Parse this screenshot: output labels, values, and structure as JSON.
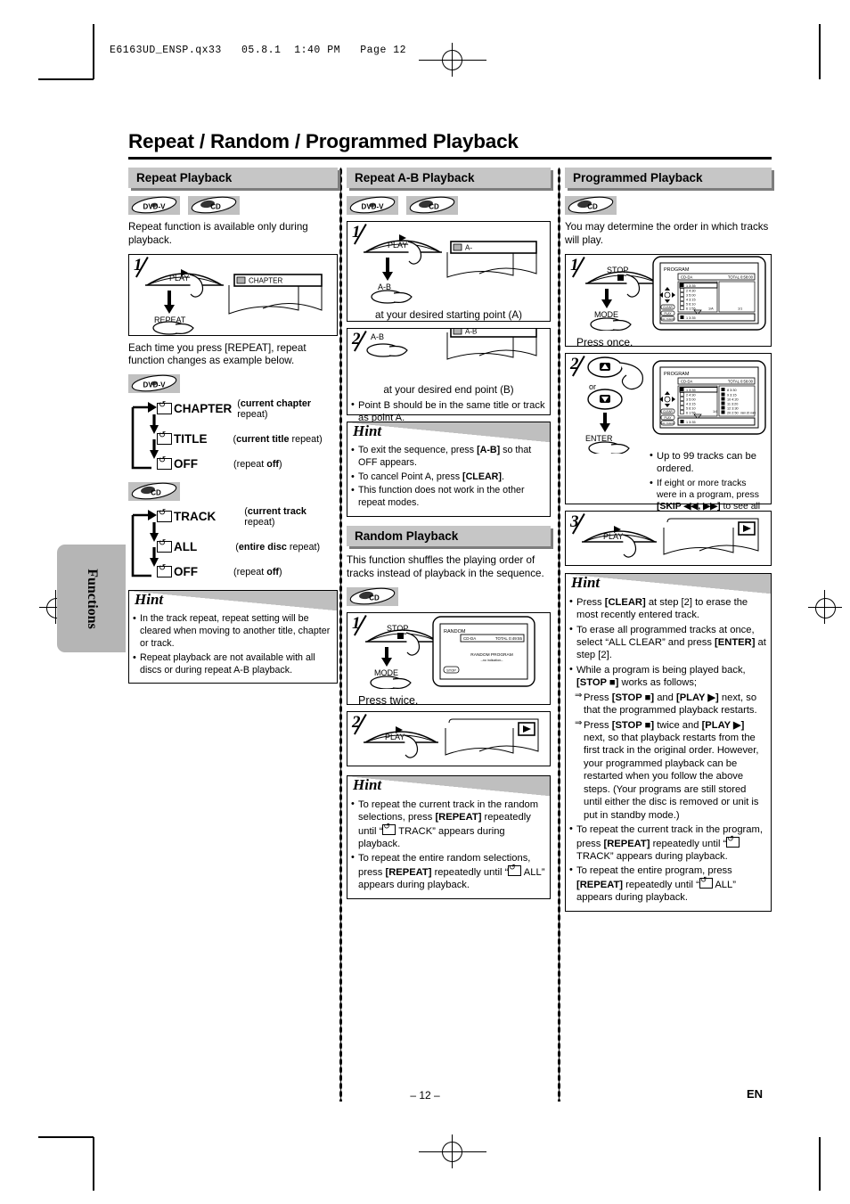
{
  "print_header": "E6163UD_ENSP.qx33   05.8.1  1:40 PM   Page 12",
  "page_title": "Repeat / Random / Programmed Playback",
  "side_tab": "Functions",
  "footer": {
    "page_number": "– 12 –",
    "lang": "EN"
  },
  "badges": {
    "dvd": "DVD-V",
    "cd": "CD"
  },
  "col1": {
    "header": "Repeat Playback",
    "intro": "Repeat function is available only during playback.",
    "step1": {
      "num": "1",
      "btn_top": "PLAY",
      "btn_bottom": "REPEAT",
      "osd": "CHAPTER"
    },
    "after_step": "Each time you press [REPEAT], repeat function changes as example below.",
    "cycle_dvd": [
      {
        "label": "CHAPTER",
        "note_b": "current chapter",
        "note_t": " repeat)"
      },
      {
        "label": "TITLE",
        "note_b": "current title",
        "note_t": " repeat)"
      },
      {
        "label": "OFF",
        "note_b": "off",
        "note_t": "(repeat "
      }
    ],
    "cycle_cd": [
      {
        "label": "TRACK",
        "note_b": "current track",
        "note_t": " repeat)"
      },
      {
        "label": "ALL",
        "note_b": "entire disc",
        "note_t": " repeat)"
      },
      {
        "label": "OFF",
        "note_b": "off",
        "note_t": "(repeat "
      }
    ],
    "hint_title": "Hint",
    "hints": [
      "In the track repeat, repeat setting will be cleared when moving to another title, chapter or track.",
      "Repeat playback are not available with all discs or during repeat A-B playback."
    ]
  },
  "col2": {
    "header": "Repeat A-B Playback",
    "step1": {
      "num": "1",
      "btn_top": "PLAY",
      "btn_bottom": "A-B",
      "osd": "A-",
      "caption": "at your desired starting point (A)"
    },
    "step2": {
      "num": "2",
      "btn_top": "A-B",
      "osd": "A-B",
      "caption": "at your desired end point (B)",
      "note": "Point B should be in the same title or track as point A."
    },
    "hint_title": "Hint",
    "hints_parts": [
      {
        "pre": "To exit the sequence, press ",
        "bold": "[A-B]",
        "post": " so that OFF appears."
      },
      {
        "pre": "To cancel Point A, press ",
        "bold": "[CLEAR]",
        "post": "."
      },
      {
        "pre": "This function does not work in the other repeat modes.",
        "bold": "",
        "post": ""
      }
    ],
    "random_header": "Random Playback",
    "random_intro": "This function shuffles the playing order of tracks instead of playback in the sequence.",
    "rstep1": {
      "num": "1",
      "btn_top": "STOP",
      "btn_bottom": "MODE",
      "caption": "Press twice.",
      "osd_title": "RANDOM",
      "osd_disc": "CD-DA",
      "osd_total": "TOTAL 0:49:55",
      "osd_center1": "RANDOM PROGRAM",
      "osd_center2": "--no indication--",
      "osd_stop": "STOP"
    },
    "rstep2": {
      "num": "2",
      "btn_top": "PLAY"
    },
    "rhint_title": "Hint",
    "rhints": [
      {
        "a": "To repeat the current track in the random selections, press ",
        "b": "[REPEAT]",
        "c": " repeatedly until “",
        "d": " TRACK” appears during playback."
      },
      {
        "a": "To repeat the entire random selections, press ",
        "b": "[REPEAT]",
        "c": " repeatedly until “",
        "d": " ALL” appears during playback."
      }
    ]
  },
  "col3": {
    "header": "Programmed Playback",
    "intro": "You may determine the order in which tracks will play.",
    "step1": {
      "num": "1",
      "btn_top": "STOP",
      "btn_bottom": "MODE",
      "caption": "Press once.",
      "osd_title": "PROGRAM",
      "osd_disc": "CD-DA",
      "osd_total": "TOTAL 0:58:00",
      "osd_tracks": [
        "1  3:35",
        "2  4:30",
        "3  5:00",
        "4  3:15",
        "5  6:10",
        "6  1:55",
        "7  3:30"
      ],
      "osd_page_l": "1/A",
      "osd_page_r": "1/1",
      "osd_sel": "1  3:35",
      "osd_btn1": "CLEAR",
      "osd_btn2": "PLAY",
      "osd_btn3": "ALL CLEAR"
    },
    "step2": {
      "num": "2",
      "btn_up": "▲",
      "or": "or",
      "btn_dn": "▼",
      "enter": "ENTER",
      "osd_title": "PROGRAM",
      "osd_disc": "CD-DA",
      "osd_total": "TOTAL 0:58:00",
      "osd_tracks": [
        "1  3:35",
        "2  4:30",
        "3  5:00",
        "4  3:15",
        "5  6:10",
        "6  1:55",
        "7  3:30"
      ],
      "osd_tracks2": [
        "8  3:30",
        "9  3:15",
        "10  4:20",
        "11  3:20",
        "12  3:30",
        "13  3:30",
        "20  2:50"
      ],
      "osd_page": "1/4",
      "osd_min": "mini  20  mini",
      "osd_sel": "1  3:35",
      "notes": [
        {
          "a": "Up to 99 tracks can be ordered.",
          "b": "",
          "c": ""
        },
        {
          "a": "If eight or more tracks were in a program, press ",
          "b": "[SKIP ◀◀, ▶▶]",
          "c": " to see all the tracks."
        }
      ]
    },
    "step3": {
      "num": "3",
      "btn_top": "PLAY"
    },
    "hint_title": "Hint",
    "hints": [
      {
        "t": "mix",
        "parts": [
          [
            "n",
            "Press "
          ],
          [
            "b",
            "[CLEAR]"
          ],
          [
            "n",
            " at step [2] to erase the most recently entered track."
          ]
        ]
      },
      {
        "t": "mix",
        "parts": [
          [
            "n",
            "To erase all programmed tracks at once, select “ALL CLEAR” and press "
          ],
          [
            "b",
            "[ENTER]"
          ],
          [
            "n",
            " at step [2]."
          ]
        ]
      },
      {
        "t": "mix",
        "parts": [
          [
            "n",
            "While a program is being played back, "
          ],
          [
            "b",
            "[STOP ■]"
          ],
          [
            "n",
            " works as follows;"
          ]
        ]
      },
      {
        "t": "arrow",
        "parts": [
          [
            "n",
            "Press "
          ],
          [
            "b",
            "[STOP ■]"
          ],
          [
            "n",
            " and "
          ],
          [
            "b",
            "[PLAY ▶]"
          ],
          [
            "n",
            " next, so that the programmed playback restarts."
          ]
        ]
      },
      {
        "t": "arrow",
        "parts": [
          [
            "n",
            "Press "
          ],
          [
            "b",
            "[STOP ■]"
          ],
          [
            "n",
            " twice and "
          ],
          [
            "b",
            "[PLAY ▶]"
          ],
          [
            "n",
            " next, so that playback restarts from the first track in the original order. However, your programmed playback can be restarted when you follow the above steps. (Your programs are still stored until either the disc is removed or unit is put in standby mode.)"
          ]
        ]
      },
      {
        "t": "icon_track",
        "parts": [
          [
            "n",
            "To repeat the current track in the program, press "
          ],
          [
            "b",
            "[REPEAT]"
          ],
          [
            "n",
            " repeatedly until “"
          ],
          [
            "i",
            ""
          ],
          [
            "n",
            " TRACK” appears during playback."
          ]
        ]
      },
      {
        "t": "icon_all",
        "parts": [
          [
            "n",
            "To repeat the entire program, press "
          ],
          [
            "b",
            "[REPEAT]"
          ],
          [
            "n",
            " repeatedly until “"
          ],
          [
            "i",
            ""
          ],
          [
            "n",
            " ALL” appears during playback."
          ]
        ]
      }
    ]
  }
}
